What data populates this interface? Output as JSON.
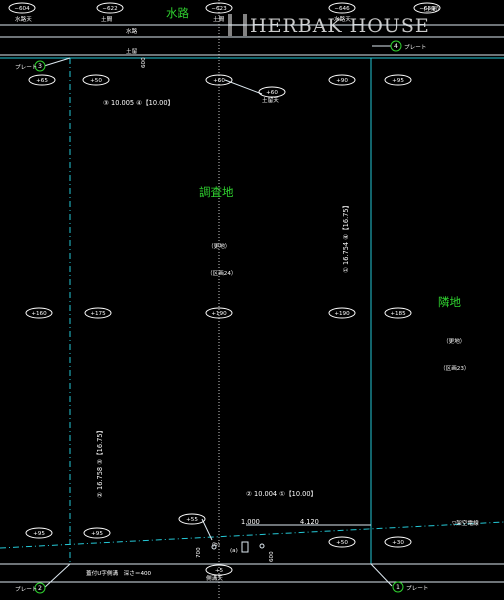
{
  "watermark": {
    "text": "HERBAK HOUSE",
    "mark": "H"
  },
  "areas": {
    "waterway": "水路",
    "survey_lot": "調査地",
    "neighbor_lot": "隣地"
  },
  "elevations": {
    "top_604": "−604",
    "top_622": "−622",
    "top_623": "−623",
    "top_646": "−646",
    "top_630": "−630",
    "a65": "+65",
    "a50": "+50",
    "a60": "+60",
    "a60b": "+60",
    "a90": "+90",
    "a95": "+95",
    "m160": "+160",
    "m175": "+175",
    "m190": "+190",
    "m190b": "+190",
    "m185": "+185",
    "b55": "+55",
    "b95": "+95",
    "b95b": "+95",
    "b50": "+50",
    "b30": "+30",
    "b5": "+5"
  },
  "labels": {
    "waterway_top_1": "水路天",
    "dirt_1": "土間",
    "dirt_2": "土間",
    "waterway_top_2": "水路天",
    "dirt_3": "（土間）",
    "waterway_mid": "水路",
    "dirt_mid": "土留",
    "dirt_top": "土留天",
    "plate": "プレート",
    "vacant_1": "（更地）",
    "block_24": "（区画24）",
    "vacant_2": "（更地）",
    "block_23": "（区画23）",
    "drain": "蓋付U字側溝　深さ＝400",
    "drain_top": "側溝天",
    "power_line": "▽架空電線",
    "b_label": "(b)",
    "a_label": "(a)"
  },
  "markers": {
    "m1": "1",
    "m2": "2",
    "m3": "3",
    "m4": "4"
  },
  "dimensions": {
    "top": "③ 10.005 ④【10.00】",
    "right": "① 16.754 ④【16.75】",
    "left": "② 16.758 ③【16.75】",
    "bottom": "② 10.004 ①【10.00】",
    "d_1000": "1.000",
    "d_4120": "4.120",
    "d_700": "700",
    "d_600": "600",
    "d_plate_top": "600"
  }
}
